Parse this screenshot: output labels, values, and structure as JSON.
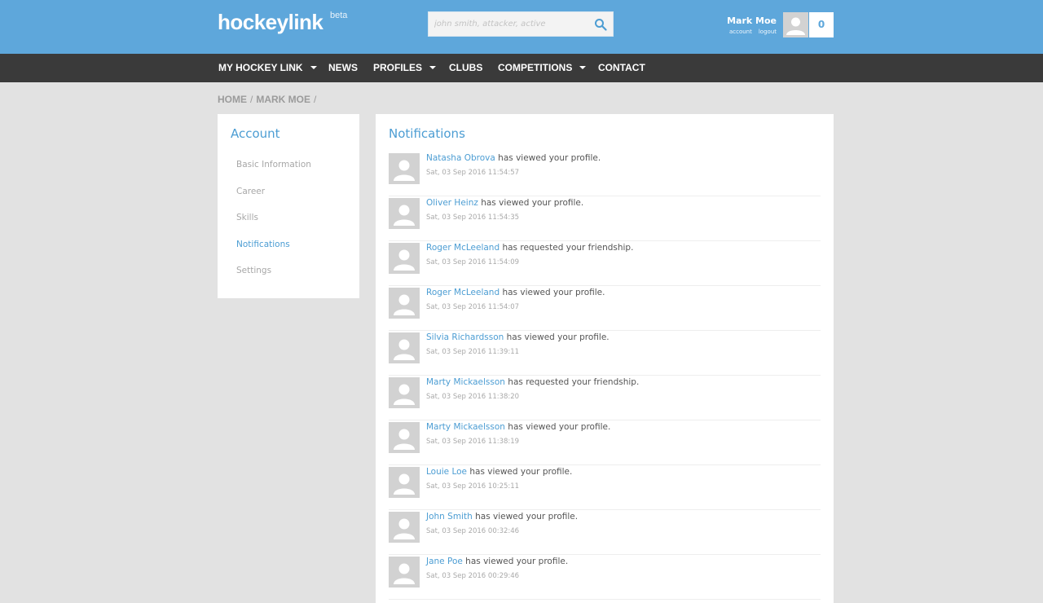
{
  "header": {
    "logo": "hockeylink",
    "beta": "beta",
    "search_placeholder": "john smith, attacker, active",
    "user_name": "Mark Moe",
    "account_link": "account",
    "logout_link": "logout",
    "notification_count": "0",
    "brand_color": "#5ea7db"
  },
  "nav": {
    "items": [
      {
        "label": "MY HOCKEY LINK",
        "dropdown": true
      },
      {
        "label": "NEWS",
        "dropdown": false
      },
      {
        "label": "PROFILES",
        "dropdown": true
      },
      {
        "label": "CLUBS",
        "dropdown": false
      },
      {
        "label": "COMPETITIONS",
        "dropdown": true
      },
      {
        "label": "CONTACT",
        "dropdown": false
      }
    ]
  },
  "breadcrumb": [
    "HOME",
    "MARK MOE"
  ],
  "sidebar": {
    "title": "Account",
    "items": [
      {
        "label": "Basic Information",
        "active": false
      },
      {
        "label": "Career",
        "active": false
      },
      {
        "label": "Skills",
        "active": false
      },
      {
        "label": "Notifications",
        "active": true
      },
      {
        "label": "Settings",
        "active": false
      }
    ]
  },
  "main": {
    "title": "Notifications",
    "notifications": [
      {
        "name": "Natasha Obrova",
        "action": " has viewed your profile.",
        "time": "Sat, 03 Sep 2016 11:54:57"
      },
      {
        "name": "Oliver Heinz",
        "action": " has viewed your profile.",
        "time": "Sat, 03 Sep 2016 11:54:35"
      },
      {
        "name": "Roger McLeeland",
        "action": " has requested your friendship.",
        "time": "Sat, 03 Sep 2016 11:54:09"
      },
      {
        "name": "Roger McLeeland",
        "action": " has viewed your profile.",
        "time": "Sat, 03 Sep 2016 11:54:07"
      },
      {
        "name": "Silvia Richardsson",
        "action": " has viewed your profile.",
        "time": "Sat, 03 Sep 2016 11:39:11"
      },
      {
        "name": "Marty Mickaelsson",
        "action": " has requested your friendship.",
        "time": "Sat, 03 Sep 2016 11:38:20"
      },
      {
        "name": "Marty Mickaelsson",
        "action": " has viewed your profile.",
        "time": "Sat, 03 Sep 2016 11:38:19"
      },
      {
        "name": "Louie Loe",
        "action": " has viewed your profile.",
        "time": "Sat, 03 Sep 2016 10:25:11"
      },
      {
        "name": "John Smith",
        "action": " has viewed your profile.",
        "time": "Sat, 03 Sep 2016 00:32:46"
      },
      {
        "name": "Jane Poe",
        "action": " has viewed your profile.",
        "time": "Sat, 03 Sep 2016 00:29:46"
      }
    ]
  },
  "colors": {
    "accent": "#4c9dd3",
    "nav_bg": "#3a3a3a",
    "page_bg": "#e2e2e2"
  }
}
